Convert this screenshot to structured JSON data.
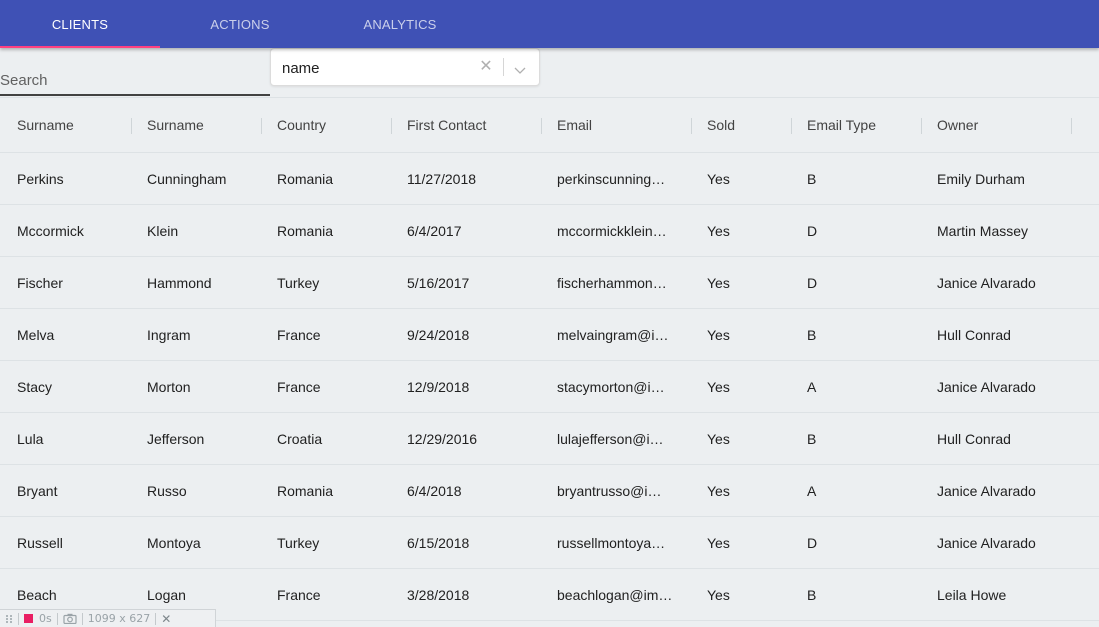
{
  "tabs": [
    {
      "label": "CLIENTS",
      "active": true
    },
    {
      "label": "ACTIONS",
      "active": false
    },
    {
      "label": "ANALYTICS",
      "active": false
    }
  ],
  "search": {
    "placeholder": "Search",
    "value": ""
  },
  "field_select": {
    "value": "name",
    "clear_icon": "close-icon",
    "dropdown_icon": "chevron-down-icon"
  },
  "table": {
    "columns": [
      "Surname",
      "Surname",
      "Country",
      "First Contact",
      "Email",
      "Sold",
      "Email Type",
      "Owner"
    ],
    "rows": [
      [
        "Perkins",
        "Cunningham",
        "Romania",
        "11/27/2018",
        "perkinscunning…",
        "Yes",
        "B",
        "Emily Durham"
      ],
      [
        "Mccormick",
        "Klein",
        "Romania",
        "6/4/2017",
        "mccormickklein…",
        "Yes",
        "D",
        "Martin Massey"
      ],
      [
        "Fischer",
        "Hammond",
        "Turkey",
        "5/16/2017",
        "fischerhammon…",
        "Yes",
        "D",
        "Janice Alvarado"
      ],
      [
        "Melva",
        "Ingram",
        "France",
        "9/24/2018",
        "melvaingram@i…",
        "Yes",
        "B",
        "Hull Conrad"
      ],
      [
        "Stacy",
        "Morton",
        "France",
        "12/9/2018",
        "stacymorton@i…",
        "Yes",
        "A",
        "Janice Alvarado"
      ],
      [
        "Lula",
        "Jefferson",
        "Croatia",
        "12/29/2016",
        "lulajefferson@i…",
        "Yes",
        "B",
        "Hull Conrad"
      ],
      [
        "Bryant",
        "Russo",
        "Romania",
        "6/4/2018",
        "bryantrusso@i…",
        "Yes",
        "A",
        "Janice Alvarado"
      ],
      [
        "Russell",
        "Montoya",
        "Turkey",
        "6/15/2018",
        "russellmontoya…",
        "Yes",
        "D",
        "Janice Alvarado"
      ],
      [
        "Beach",
        "Logan",
        "France",
        "3/28/2018",
        "beachlogan@im…",
        "Yes",
        "B",
        "Leila Howe"
      ]
    ]
  },
  "status_bar": {
    "timer": "0s",
    "dimensions": "1099 x 627",
    "icons": [
      "drag-handle-icon",
      "record-icon",
      "camera-icon",
      "close-icon"
    ]
  },
  "colors": {
    "appbar": "#3f51b5",
    "tab_indicator": "#ff4081",
    "background": "#eceff1",
    "record": "#e91e63"
  }
}
